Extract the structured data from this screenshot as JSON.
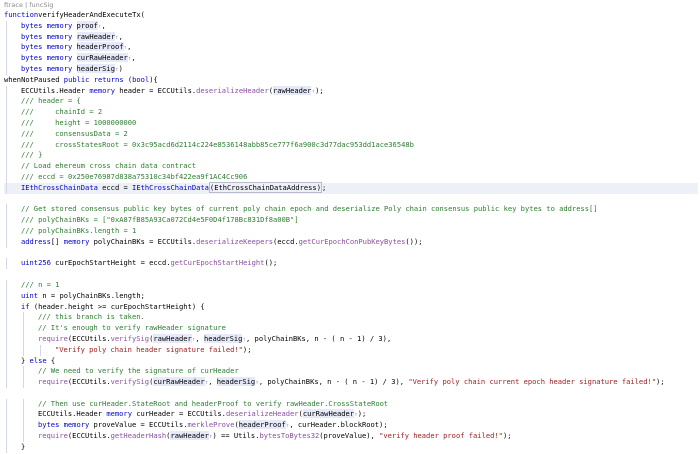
{
  "breadcrumb": "ftrace | funcSig",
  "colors": {
    "keyword": "#0000cc",
    "function": "#8a4fa0",
    "comment": "#2e7d32",
    "string": "#a02020",
    "param_highlight": "#e6e9f7",
    "line_highlight": "#eef0f8"
  },
  "lines": [
    {
      "indent": 0,
      "tokens": [
        [
          "kw",
          "function"
        ],
        [
          "",
          "verifyHeaderAndExecuteTx("
        ]
      ]
    },
    {
      "indent": 1,
      "tokens": [
        [
          "ty",
          "bytes"
        ],
        [
          "kw",
          " memory "
        ],
        [
          "pm",
          "proof"
        ],
        [
          "pmk",
          "↑"
        ],
        [
          "",
          ","
        ]
      ]
    },
    {
      "indent": 1,
      "tokens": [
        [
          "ty",
          "bytes"
        ],
        [
          "kw",
          " memory "
        ],
        [
          "pm",
          "rawHeader"
        ],
        [
          "pmk",
          "↑"
        ],
        [
          "",
          ","
        ]
      ]
    },
    {
      "indent": 1,
      "tokens": [
        [
          "ty",
          "bytes"
        ],
        [
          "kw",
          " memory "
        ],
        [
          "pm",
          "headerProof"
        ],
        [
          "pmk",
          "↑"
        ],
        [
          "",
          ","
        ]
      ]
    },
    {
      "indent": 1,
      "tokens": [
        [
          "ty",
          "bytes"
        ],
        [
          "kw",
          " memory "
        ],
        [
          "pm",
          "curRawHeader"
        ],
        [
          "pmk",
          "↑"
        ],
        [
          "",
          ","
        ]
      ]
    },
    {
      "indent": 1,
      "tokens": [
        [
          "ty",
          "bytes"
        ],
        [
          "kw",
          " memory "
        ],
        [
          "pm",
          "headerSig"
        ],
        [
          "pmk",
          "↑"
        ],
        [
          "",
          ")"
        ]
      ]
    },
    {
      "indent": 0,
      "tokens": [
        [
          "",
          "whenNotPaused "
        ],
        [
          "kw",
          "public returns"
        ],
        [
          "",
          " ("
        ],
        [
          "ty",
          "bool"
        ],
        [
          "",
          ")"
        ],
        [
          "",
          "{"
        ]
      ]
    },
    {
      "indent": 1,
      "tokens": [
        [
          "",
          "ECCUtils.Header "
        ],
        [
          "kw",
          "memory"
        ],
        [
          "",
          " header = ECCUtils."
        ],
        [
          "fn",
          "deserializeHeader"
        ],
        [
          "",
          "("
        ],
        [
          "pm",
          "rawHeader"
        ],
        [
          "pmk",
          "↑"
        ],
        [
          "",
          ");"
        ]
      ]
    },
    {
      "indent": 1,
      "tokens": [
        [
          "cm",
          "/// header = {"
        ]
      ]
    },
    {
      "indent": 1,
      "tokens": [
        [
          "cm",
          "///     chainId = 2"
        ]
      ]
    },
    {
      "indent": 1,
      "tokens": [
        [
          "cm",
          "///     height = 1000000000"
        ]
      ]
    },
    {
      "indent": 1,
      "tokens": [
        [
          "cm",
          "///     consensusData = 2"
        ]
      ]
    },
    {
      "indent": 1,
      "tokens": [
        [
          "cm",
          "///     crossStatesRoot = 0x3c95acd6d2114c224e8536148abb85ce777f6a900c3d77dac953dd1ace36548b"
        ]
      ]
    },
    {
      "indent": 1,
      "tokens": [
        [
          "cm",
          "/// }"
        ]
      ]
    },
    {
      "indent": 1,
      "tokens": [
        [
          "cm",
          "// Load ehereum cross chain data contract"
        ]
      ]
    },
    {
      "indent": 1,
      "tokens": [
        [
          "cm",
          "/// eccd = 0x250e76987d838a75310c34bf422ea9f1AC4Cc906"
        ]
      ]
    },
    {
      "indent": 1,
      "hl": true,
      "tokens": [
        [
          "ty",
          "IEthCrossChainData"
        ],
        [
          "",
          " eccd = "
        ],
        [
          "ty",
          "IEthCrossChainData"
        ],
        [
          "box",
          "(EthCrossChainDataAddress)"
        ],
        [
          "",
          ";"
        ]
      ]
    },
    {
      "indent": 0,
      "tokens": []
    },
    {
      "indent": 1,
      "tokens": [
        [
          "cm",
          "// Get stored consensus public key bytes of current poly chain epoch and deserialize Poly chain consensus public key bytes to address[]"
        ]
      ]
    },
    {
      "indent": 1,
      "tokens": [
        [
          "cm",
          "/// polyChainBKs = [\"0xA87fB85A93Ca072Cd4e5F0D4f178Bc831Df8a00B\"]"
        ]
      ]
    },
    {
      "indent": 1,
      "tokens": [
        [
          "cm",
          "/// polyChainBKs.length = 1"
        ]
      ]
    },
    {
      "indent": 1,
      "tokens": [
        [
          "ty",
          "address"
        ],
        [
          "",
          "[] "
        ],
        [
          "kw",
          "memory"
        ],
        [
          "",
          " polyChainBKs = ECCUtils."
        ],
        [
          "fn",
          "deserializeKeepers"
        ],
        [
          "",
          "(eccd."
        ],
        [
          "fn",
          "getCurEpochConPubKeyBytes"
        ],
        [
          "",
          "());"
        ]
      ]
    },
    {
      "indent": 0,
      "tokens": []
    },
    {
      "indent": 1,
      "tokens": [
        [
          "ty",
          "uint256"
        ],
        [
          "",
          " curEpochStartHeight = eccd."
        ],
        [
          "fn",
          "getCurEpochStartHeight"
        ],
        [
          "",
          "();"
        ]
      ]
    },
    {
      "indent": 0,
      "tokens": []
    },
    {
      "indent": 1,
      "tokens": [
        [
          "cm",
          "/// n = 1"
        ]
      ]
    },
    {
      "indent": 1,
      "tokens": [
        [
          "ty",
          "uint"
        ],
        [
          "",
          " n = polyChainBKs.length;"
        ]
      ]
    },
    {
      "indent": 1,
      "tokens": [
        [
          "kw",
          "if"
        ],
        [
          "",
          " (header.height >= curEpochStartHeight) {"
        ]
      ]
    },
    {
      "indent": 2,
      "tokens": [
        [
          "cm",
          "/// this branch is taken."
        ]
      ]
    },
    {
      "indent": 2,
      "tokens": [
        [
          "cm",
          "// It's enough to verify rawHeader signature"
        ]
      ]
    },
    {
      "indent": 2,
      "tokens": [
        [
          "fn",
          "require"
        ],
        [
          "",
          "(ECCUtils."
        ],
        [
          "fn",
          "verifySig"
        ],
        [
          "",
          "("
        ],
        [
          "pm",
          "rawHeader"
        ],
        [
          "pmk",
          "↑"
        ],
        [
          "",
          ", "
        ],
        [
          "pm",
          "headerSig"
        ],
        [
          "pmk",
          "↑"
        ],
        [
          "",
          ", polyChainBKs, n - ( n - 1) / 3),"
        ]
      ]
    },
    {
      "indent": 3,
      "tokens": [
        [
          "st",
          "\"Verify poly chain header signature failed!\""
        ],
        [
          "",
          ");"
        ]
      ]
    },
    {
      "indent": 1,
      "tokens": [
        [
          "",
          "} "
        ],
        [
          "kw",
          "else"
        ],
        [
          "",
          " {"
        ]
      ]
    },
    {
      "indent": 2,
      "tokens": [
        [
          "cm",
          "// We need to verify the signature of curHeader"
        ]
      ]
    },
    {
      "indent": 2,
      "tokens": [
        [
          "fn",
          "require"
        ],
        [
          "",
          "(ECCUtils."
        ],
        [
          "fn",
          "verifySig"
        ],
        [
          "",
          "("
        ],
        [
          "pm",
          "curRawHeader"
        ],
        [
          "pmk",
          "↑"
        ],
        [
          "",
          ", "
        ],
        [
          "pm",
          "headerSig"
        ],
        [
          "pmk",
          "↑"
        ],
        [
          "",
          ", polyChainBKs, n - ( n - 1) / 3), "
        ],
        [
          "st",
          "\"Verify poly chain current epoch header signature failed!\""
        ],
        [
          "",
          ");"
        ]
      ]
    },
    {
      "indent": 0,
      "tokens": []
    },
    {
      "indent": 2,
      "tokens": [
        [
          "cm",
          "// Then use curHeader.StateRoot and headerProof to verify rawHeader.CrossStateRoot"
        ]
      ]
    },
    {
      "indent": 2,
      "tokens": [
        [
          "",
          "ECCUtils.Header "
        ],
        [
          "kw",
          "memory"
        ],
        [
          "",
          " curHeader = ECCUtils."
        ],
        [
          "fn",
          "deserializeHeader"
        ],
        [
          "",
          "("
        ],
        [
          "pm",
          "curRawHeader"
        ],
        [
          "pmk",
          "↑"
        ],
        [
          "",
          ");"
        ]
      ]
    },
    {
      "indent": 2,
      "tokens": [
        [
          "ty",
          "bytes"
        ],
        [
          "kw",
          " memory"
        ],
        [
          "",
          " proveValue = ECCUtils."
        ],
        [
          "fn",
          "merkleProve"
        ],
        [
          "",
          "("
        ],
        [
          "pm",
          "headerProof"
        ],
        [
          "pmk",
          "↑"
        ],
        [
          "",
          ", curHeader.blockRoot);"
        ]
      ]
    },
    {
      "indent": 2,
      "tokens": [
        [
          "fn",
          "require"
        ],
        [
          "",
          "(ECCUtils."
        ],
        [
          "fn",
          "getHeaderHash"
        ],
        [
          "",
          "("
        ],
        [
          "pm",
          "rawHeader"
        ],
        [
          "pmk",
          "↑"
        ],
        [
          "",
          ") == Utils."
        ],
        [
          "fn",
          "bytesToBytes32"
        ],
        [
          "",
          "(proveValue), "
        ],
        [
          "st",
          "\"verify header proof failed!\""
        ],
        [
          "",
          ");"
        ]
      ]
    },
    {
      "indent": 1,
      "tokens": [
        [
          "",
          "}"
        ]
      ]
    }
  ]
}
